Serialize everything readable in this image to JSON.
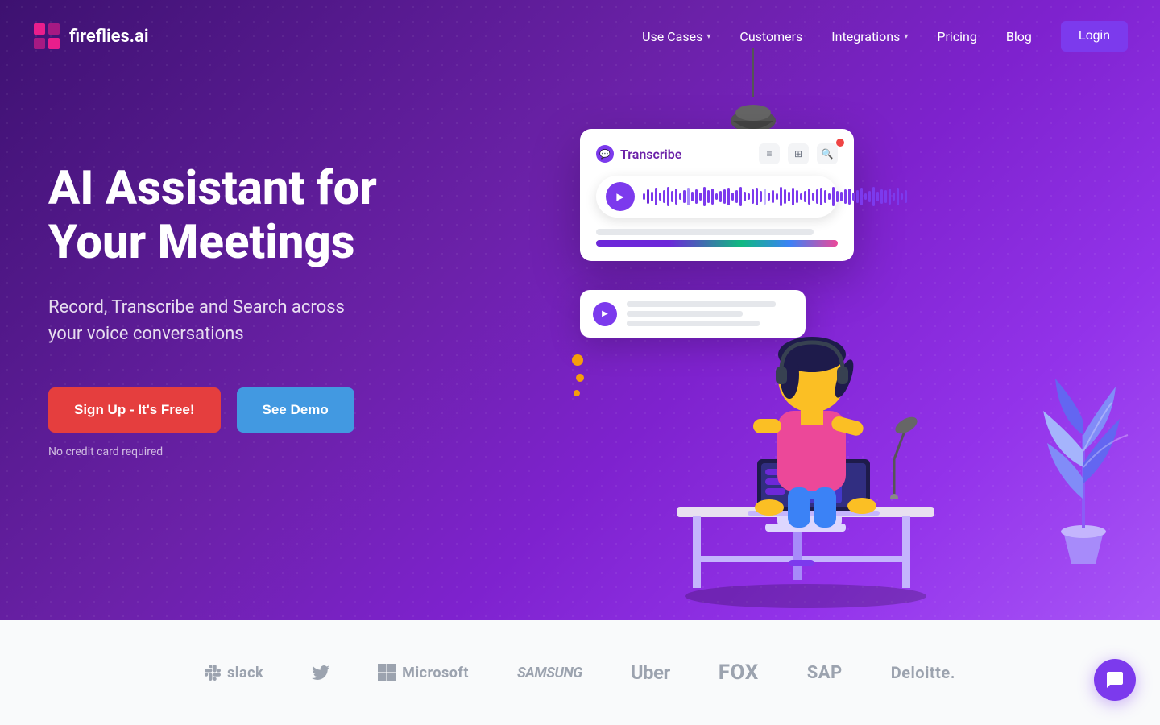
{
  "logo": {
    "text": "fireflies.ai"
  },
  "nav": {
    "use_cases_label": "Use Cases",
    "customers_label": "Customers",
    "integrations_label": "Integrations",
    "pricing_label": "Pricing",
    "blog_label": "Blog",
    "login_label": "Login"
  },
  "hero": {
    "headline_line1": "AI Assistant for",
    "headline_line2": "Your Meetings",
    "subtext_line1": "Record, Transcribe and Search across",
    "subtext_line2": "your voice conversations",
    "signup_label": "Sign Up - It's Free!",
    "demo_label": "See Demo",
    "no_cc_label": "No credit card required"
  },
  "transcribe_card": {
    "label": "Transcribe"
  },
  "brands": [
    {
      "name": "Slack",
      "icon": "slack"
    },
    {
      "name": "Twitter",
      "icon": "twitter"
    },
    {
      "name": "Microsoft",
      "icon": "microsoft"
    },
    {
      "name": "Samsung",
      "icon": "samsung"
    },
    {
      "name": "Uber",
      "icon": "uber"
    },
    {
      "name": "FOX",
      "icon": "fox"
    },
    {
      "name": "SAP",
      "icon": "sap"
    },
    {
      "name": "Deloitte.",
      "icon": "deloitte"
    }
  ],
  "chat": {
    "icon": "chat-icon"
  }
}
